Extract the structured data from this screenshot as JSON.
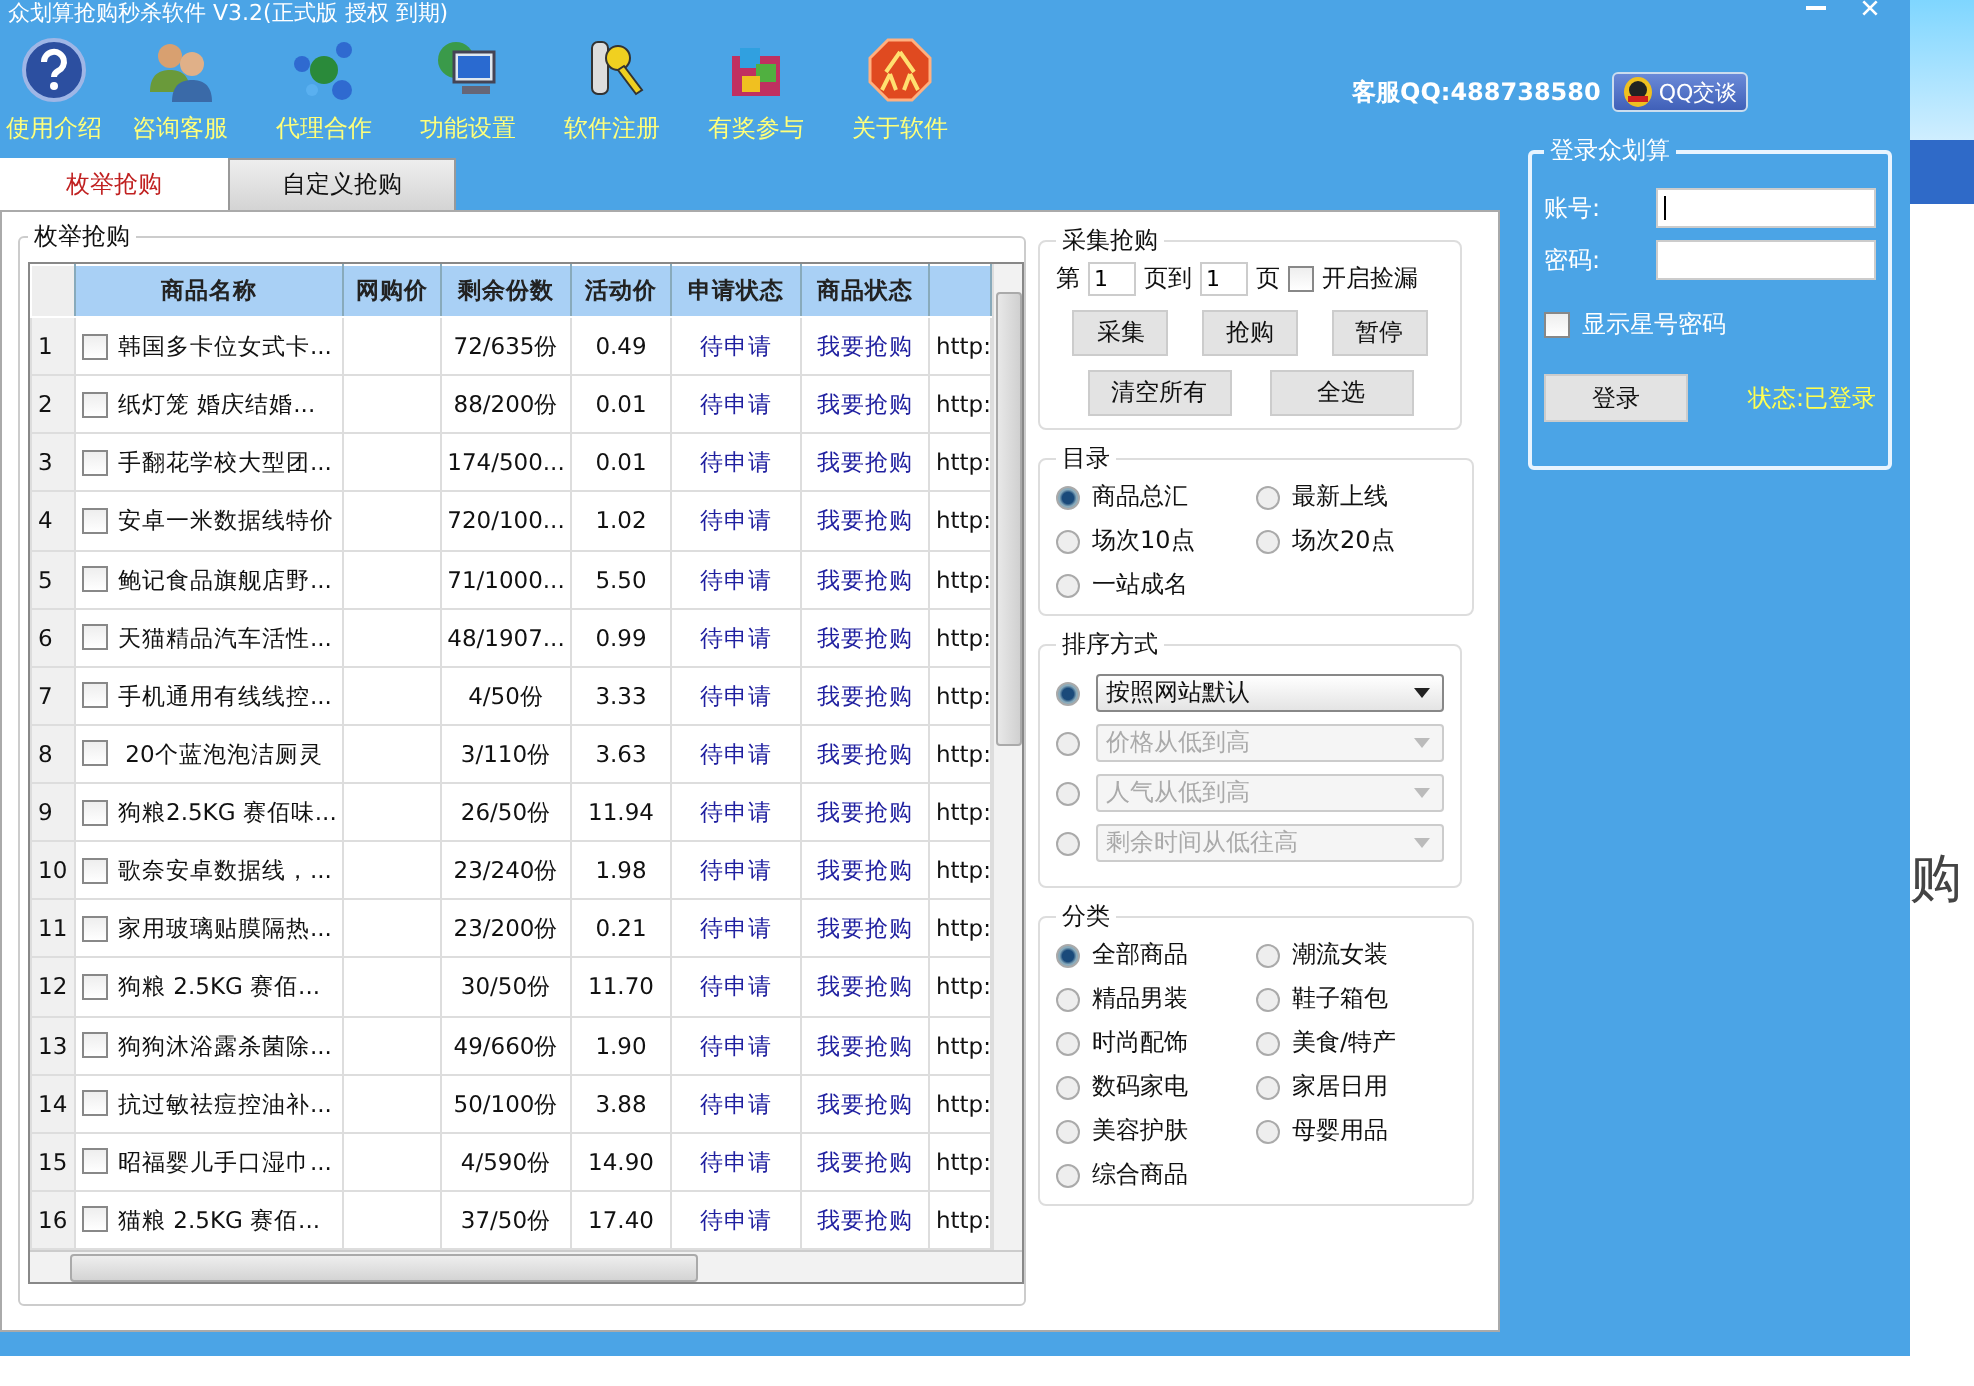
{
  "window": {
    "title": "众划算抢购秒杀软件 V3.2(正式版 授权 到期)"
  },
  "toolbar": [
    {
      "label": "使用介绍",
      "kind": "help"
    },
    {
      "label": "咨询客服",
      "kind": "people"
    },
    {
      "label": "代理合作",
      "kind": "network"
    },
    {
      "label": "功能设置",
      "kind": "computer"
    },
    {
      "label": "软件注册",
      "kind": "key"
    },
    {
      "label": "有奖参与",
      "kind": "box"
    },
    {
      "label": "关于软件",
      "kind": "logo"
    }
  ],
  "support": {
    "text": "客服QQ:488738580",
    "button": "QQ交谈"
  },
  "tabs": [
    {
      "label": "枚举抢购",
      "selected": true
    },
    {
      "label": "自定义抢购",
      "selected": false
    }
  ],
  "panel_title": "枚举抢购",
  "table": {
    "columns": [
      "商品名称",
      "网购价",
      "剩余份数",
      "活动价",
      "申请状态",
      "商品状态"
    ],
    "rows": [
      {
        "num": "1",
        "checked": false,
        "name": "韩国多卡位女式卡...",
        "remaining": "72/635份",
        "price": "0.49",
        "apply": "待申请",
        "status": "我要抢购",
        "url": "http:"
      },
      {
        "num": "2",
        "checked": false,
        "name": "纸灯笼 婚庆结婚...",
        "remaining": "88/200份",
        "price": "0.01",
        "apply": "待申请",
        "status": "我要抢购",
        "url": "http:"
      },
      {
        "num": "3",
        "checked": false,
        "name": "手翻花学校大型团...",
        "remaining": "174/500...",
        "price": "0.01",
        "apply": "待申请",
        "status": "我要抢购",
        "url": "http:"
      },
      {
        "num": "4",
        "checked": false,
        "name": "安卓一米数据线特价",
        "remaining": "720/100...",
        "price": "1.02",
        "apply": "待申请",
        "status": "我要抢购",
        "url": "http:"
      },
      {
        "num": "5",
        "checked": false,
        "name": "鲍记食品旗舰店野...",
        "remaining": "71/1000...",
        "price": "5.50",
        "apply": "待申请",
        "status": "我要抢购",
        "url": "http:"
      },
      {
        "num": "6",
        "checked": false,
        "name": "天猫精品汽车活性...",
        "remaining": "48/1907...",
        "price": "0.99",
        "apply": "待申请",
        "status": "我要抢购",
        "url": "http:"
      },
      {
        "num": "7",
        "checked": false,
        "name": "手机通用有线线控...",
        "remaining": "4/50份",
        "price": "3.33",
        "apply": "待申请",
        "status": "我要抢购",
        "url": "http:"
      },
      {
        "num": "8",
        "checked": false,
        "name": " 20个蓝泡泡洁厕灵",
        "remaining": "3/110份",
        "price": "3.63",
        "apply": "待申请",
        "status": "我要抢购",
        "url": "http:"
      },
      {
        "num": "9",
        "checked": false,
        "name": "狗粮2.5KG 赛佰味...",
        "remaining": "26/50份",
        "price": "11.94",
        "apply": "待申请",
        "status": "我要抢购",
        "url": "http:"
      },
      {
        "num": "10",
        "checked": false,
        "name": "歌奈安卓数据线，...",
        "remaining": "23/240份",
        "price": "1.98",
        "apply": "待申请",
        "status": "我要抢购",
        "url": "http:"
      },
      {
        "num": "11",
        "checked": false,
        "name": "家用玻璃贴膜隔热...",
        "remaining": "23/200份",
        "price": "0.21",
        "apply": "待申请",
        "status": "我要抢购",
        "url": "http:"
      },
      {
        "num": "12",
        "checked": false,
        "name": "狗粮 2.5KG 赛佰...",
        "remaining": "30/50份",
        "price": "11.70",
        "apply": "待申请",
        "status": "我要抢购",
        "url": "http:"
      },
      {
        "num": "13",
        "checked": false,
        "name": "狗狗沐浴露杀菌除...",
        "remaining": "49/660份",
        "price": "1.90",
        "apply": "待申请",
        "status": "我要抢购",
        "url": "http:"
      },
      {
        "num": "14",
        "checked": false,
        "name": "抗过敏祛痘控油补...",
        "remaining": "50/100份",
        "price": "3.88",
        "apply": "待申请",
        "status": "我要抢购",
        "url": "http:"
      },
      {
        "num": "15",
        "checked": false,
        "name": "昭福婴儿手口湿巾...",
        "remaining": "4/590份",
        "price": "14.90",
        "apply": "待申请",
        "status": "我要抢购",
        "url": "http:"
      },
      {
        "num": "16",
        "checked": false,
        "name": "猫粮 2.5KG 赛佰...",
        "remaining": "37/50份",
        "price": "17.40",
        "apply": "待申请",
        "status": "我要抢购",
        "url": "http:"
      }
    ]
  },
  "collect": {
    "title": "采集抢购",
    "page_prefix": "第",
    "from_page": "1",
    "mid": "页到",
    "to_page": "1",
    "suffix": "页",
    "pickup": {
      "label": "开启捡漏",
      "checked": false
    },
    "buttons": [
      "采集",
      "抢购",
      "暂停"
    ],
    "buttons2": [
      "清空所有",
      "全选"
    ]
  },
  "catalog": {
    "title": "目录",
    "options": [
      {
        "label": "商品总汇",
        "selected": true
      },
      {
        "label": "最新上线",
        "selected": false
      },
      {
        "label": "场次10点",
        "selected": false
      },
      {
        "label": "场次20点",
        "selected": false
      },
      {
        "label": "一站成名",
        "selected": false
      }
    ]
  },
  "sort": {
    "title": "排序方式",
    "options": [
      {
        "label": "按照网站默认",
        "selected": true
      },
      {
        "label": "价格从低到高",
        "selected": false
      },
      {
        "label": "人气从低到高",
        "selected": false
      },
      {
        "label": "剩余时间从低往高",
        "selected": false
      }
    ]
  },
  "category": {
    "title": "分类",
    "options": [
      {
        "label": "全部商品",
        "selected": true
      },
      {
        "label": "潮流女装",
        "selected": false
      },
      {
        "label": "精品男装",
        "selected": false
      },
      {
        "label": "鞋子箱包",
        "selected": false
      },
      {
        "label": "时尚配饰",
        "selected": false
      },
      {
        "label": "美食/特产",
        "selected": false
      },
      {
        "label": "数码家电",
        "selected": false
      },
      {
        "label": "家居日用",
        "selected": false
      },
      {
        "label": "美容护肤",
        "selected": false
      },
      {
        "label": "母婴用品",
        "selected": false
      },
      {
        "label": "综合商品",
        "selected": false
      }
    ]
  },
  "login": {
    "title": "登录众划算",
    "account_label": "账号:",
    "password_label": "密码:",
    "show_password": {
      "label": "显示星号密码",
      "checked": false
    },
    "button": "登录",
    "state": "状态:已登录"
  },
  "background_window": {
    "text": "购"
  }
}
